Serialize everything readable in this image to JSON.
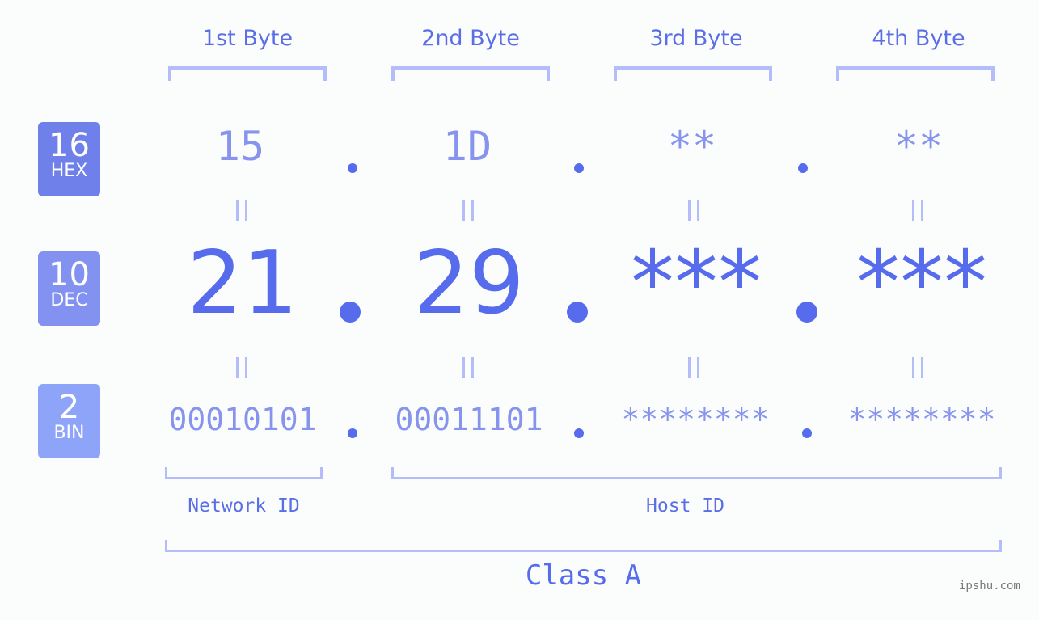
{
  "bytes": [
    {
      "header": "1st Byte",
      "hex": "15",
      "dec": "21",
      "bin": "00010101"
    },
    {
      "header": "2nd Byte",
      "hex": "1D",
      "dec": "29",
      "bin": "00011101"
    },
    {
      "header": "3rd Byte",
      "hex": "**",
      "dec": "***",
      "bin": "********"
    },
    {
      "header": "4th Byte",
      "hex": "**",
      "dec": "***",
      "bin": "********"
    }
  ],
  "badges": {
    "hex": {
      "num": "16",
      "label": "HEX",
      "color": "#6f80ea"
    },
    "dec": {
      "num": "10",
      "label": "DEC",
      "color": "#8392f0"
    },
    "bin": {
      "num": "2",
      "label": "BIN",
      "color": "#8ea4f8"
    }
  },
  "labels": {
    "network": "Network ID",
    "host": "Host ID",
    "class": "Class A"
  },
  "watermark": "ipshu.com",
  "colors": {
    "accent": "#566ced",
    "light_accent": "#8794ed",
    "bracket": "#b4bdf9"
  }
}
